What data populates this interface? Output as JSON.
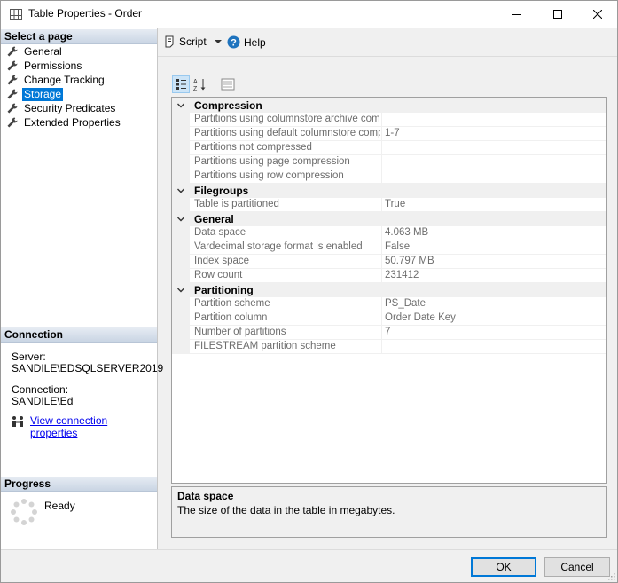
{
  "window": {
    "title": "Table Properties - Order"
  },
  "left_panel": {
    "select_page_header": "Select a page",
    "pages": [
      {
        "label": "General",
        "selected": false
      },
      {
        "label": "Permissions",
        "selected": false
      },
      {
        "label": "Change Tracking",
        "selected": false
      },
      {
        "label": "Storage",
        "selected": true
      },
      {
        "label": "Security Predicates",
        "selected": false
      },
      {
        "label": "Extended Properties",
        "selected": false
      }
    ],
    "connection_header": "Connection",
    "server_label": "Server:",
    "server_value": "SANDILE\\EDSQLSERVER2019",
    "connection_label": "Connection:",
    "connection_value": "SANDILE\\Ed",
    "view_connection_link": "View connection properties",
    "progress_header": "Progress",
    "progress_status": "Ready"
  },
  "toolbar": {
    "script_label": "Script",
    "help_label": "Help"
  },
  "property_grid": {
    "categories": [
      {
        "name": "Compression",
        "rows": [
          {
            "name": "Partitions using columnstore archive compres",
            "value": ""
          },
          {
            "name": "Partitions using default columnstore compres",
            "value": "1-7"
          },
          {
            "name": "Partitions not compressed",
            "value": ""
          },
          {
            "name": "Partitions using page compression",
            "value": ""
          },
          {
            "name": "Partitions using row compression",
            "value": ""
          }
        ]
      },
      {
        "name": "Filegroups",
        "rows": [
          {
            "name": "Table is partitioned",
            "value": "True"
          }
        ]
      },
      {
        "name": "General",
        "rows": [
          {
            "name": "Data space",
            "value": "4.063 MB"
          },
          {
            "name": "Vardecimal storage format is enabled",
            "value": "False"
          },
          {
            "name": "Index space",
            "value": "50.797 MB"
          },
          {
            "name": "Row count",
            "value": "231412"
          }
        ]
      },
      {
        "name": "Partitioning",
        "rows": [
          {
            "name": "Partition scheme",
            "value": "PS_Date"
          },
          {
            "name": "Partition column",
            "value": "Order Date Key"
          },
          {
            "name": "Number of partitions",
            "value": "7"
          },
          {
            "name": "FILESTREAM partition scheme",
            "value": ""
          }
        ]
      }
    ]
  },
  "description": {
    "title": "Data space",
    "text": "The size of the data in the table in megabytes."
  },
  "buttons": {
    "ok_label": "OK",
    "cancel_label": "Cancel"
  },
  "colors": {
    "selection": "#0078d7",
    "link": "#0000ee",
    "header_gradient_top": "#e7ecf3",
    "header_gradient_bottom": "#c9d5e4"
  }
}
